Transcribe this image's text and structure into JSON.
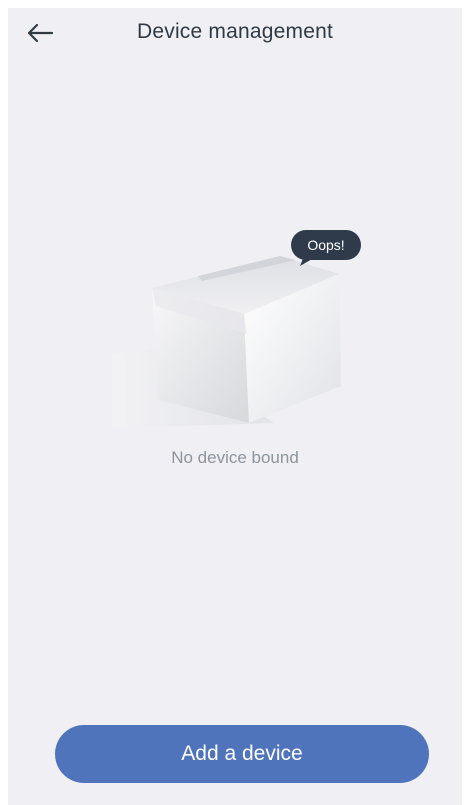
{
  "header": {
    "title": "Device management",
    "back_icon": "arrow-left-icon"
  },
  "empty_state": {
    "illustration": "empty-box-illustration",
    "bubble_text": "Oops!",
    "message": "No device bound"
  },
  "actions": {
    "add_device_label": "Add a device"
  },
  "colors": {
    "background": "#efeff4",
    "title": "#2f3a45",
    "message": "#8d949c",
    "button": "#4f74bb",
    "bubble": "#2f3b4b"
  }
}
